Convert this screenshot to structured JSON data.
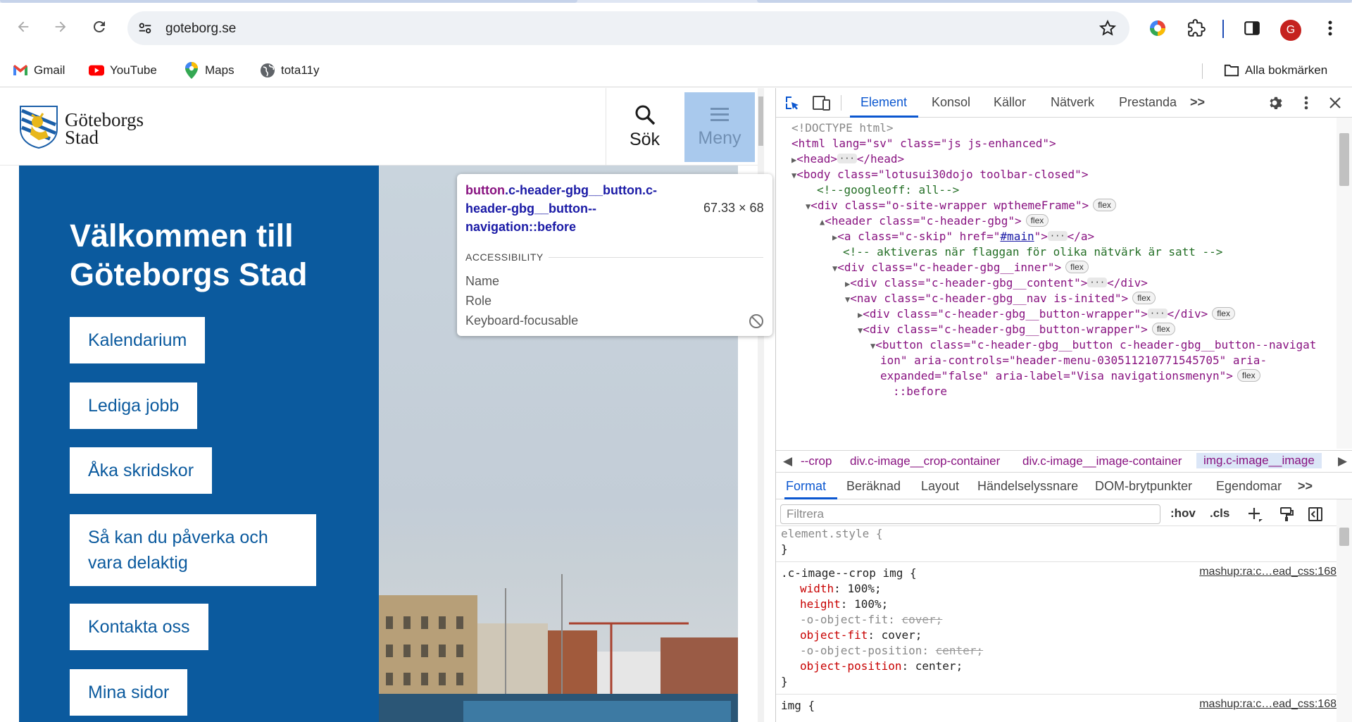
{
  "browser": {
    "url": "goteborg.se",
    "bookmarks": [
      {
        "label": "Gmail",
        "icon": "gmail-icon"
      },
      {
        "label": "YouTube",
        "icon": "youtube-icon"
      },
      {
        "label": "Maps",
        "icon": "maps-icon"
      },
      {
        "label": "tota11y",
        "icon": "globe-icon"
      }
    ],
    "all_bookmarks": "Alla bokmärken",
    "avatar_letter": "G",
    "accent": "#0b57d0"
  },
  "site": {
    "logo_line1": "Göteborgs",
    "logo_line2": "Stad",
    "search_label": "Sök",
    "menu_label": "Meny",
    "hero_title": "Välkommen till Göteborgs Stad",
    "links": [
      "Kalendarium",
      "Lediga jobb",
      "Åka skridskor",
      "Så kan du påverka och vara delaktig",
      "Kontakta oss",
      "Mina sidor"
    ],
    "brand_color": "#0b5a9e"
  },
  "tooltip": {
    "selector_tag": "button",
    "selector_classes": ".c-header-gbg__button.c-header-gbg__button--navigation::before",
    "dimensions": "67.33 × 68",
    "section": "ACCESSIBILITY",
    "props": [
      "Name",
      "Role",
      "Keyboard-focusable"
    ]
  },
  "devtools": {
    "tabs": [
      "Element",
      "Konsol",
      "Källor",
      "Nätverk",
      "Prestanda"
    ],
    "active_tab": "Element",
    "breadcrumbs": [
      "--crop",
      "div.c-image__crop-container",
      "div.c-image__image-container",
      "img.c-image__image"
    ],
    "style_tabs": [
      "Format",
      "Beräknad",
      "Layout",
      "Händelselyssnare",
      "DOM-brytpunkter",
      "Egendomar"
    ],
    "filter_placeholder": "Filtrera",
    "hov": ":hov",
    "cls": ".cls",
    "src1": "mashup:ra:c…ead_css:168",
    "src2": "mashup:ra:c…ead_css:168",
    "dom": {
      "doctype": "<!DOCTYPE html>",
      "html_open": "<html lang=\"sv\" class=\"js js-enhanced\">",
      "head": "<head>",
      "head_close": "</head>",
      "body": "<body class=\"lotusui30dojo toolbar-closed\">",
      "comment1": "<!--googleoff: all-->",
      "div_wrapper": "<div class=\"o-site-wrapper wpthemeFrame\">",
      "header": "<header class=\"c-header-gbg\">",
      "a_skip_pre": "<a class=\"c-skip\" href=\"",
      "a_skip_href": "#main",
      "a_skip_post": "\">",
      "a_close": "</a>",
      "comment2": "<!-- aktiveras när flaggan för olika nätvärk är satt -->",
      "div_inner": "<div class=\"c-header-gbg__inner\">",
      "div_content": "<div class=\"c-header-gbg__content\">",
      "div_close": "</div>",
      "nav": "<nav class=\"c-header-gbg__nav is-inited\">",
      "btn_wrapper": "<div class=\"c-header-gbg__button-wrapper\">",
      "button_line1": "<button class=\"c-header-gbg__button c-header-gbg__button--navigat",
      "button_line2": "ion\" aria-controls=\"header-menu-030511210771545705\" aria-",
      "button_line3": "expanded=\"false\" aria-label=\"Visa navigationsmenyn\">",
      "before": "::before",
      "flex": "flex"
    },
    "styles": {
      "element_style": "element.style {",
      "close": "}",
      "rule1_selector": ".c-image--crop img {",
      "decls": [
        {
          "name": "width",
          "value": "100%;",
          "strike": false
        },
        {
          "name": "height",
          "value": "100%;",
          "strike": false
        },
        {
          "name": "-o-object-fit",
          "value": "cover;",
          "strike": true
        },
        {
          "name": "object-fit",
          "value": "cover;",
          "strike": false
        },
        {
          "name": "-o-object-position",
          "value": "center;",
          "strike": true
        },
        {
          "name": "object-position",
          "value": "center;",
          "strike": false
        }
      ],
      "rule2_selector": "img {"
    }
  }
}
